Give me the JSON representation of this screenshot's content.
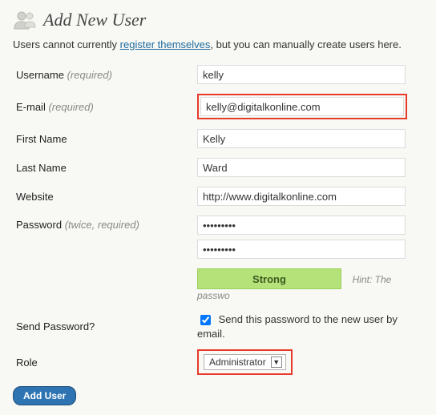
{
  "header": {
    "title": "Add New User"
  },
  "intro": {
    "before": "Users cannot currently ",
    "link": "register themselves",
    "after": ", but you can manually create users here."
  },
  "labels": {
    "username": "Username",
    "email": "E-mail",
    "first_name": "First Name",
    "last_name": "Last Name",
    "website": "Website",
    "password": "Password",
    "send_password": "Send Password?",
    "role": "Role",
    "required": "(required)",
    "twice_required": "(twice, required)"
  },
  "values": {
    "username": "kelly",
    "email": "kelly@digitalkonline.com",
    "first_name": "Kelly",
    "last_name": "Ward",
    "website": "http://www.digitalkonline.com",
    "password": "•••••••••",
    "password_confirm": "•••••••••",
    "send_password_checked": true,
    "role_selected": "Administrator"
  },
  "strength": {
    "label": "Strong",
    "hint": "Hint: The passwo"
  },
  "send_password_text": "Send this password to the new user by email.",
  "buttons": {
    "submit": "Add User"
  }
}
